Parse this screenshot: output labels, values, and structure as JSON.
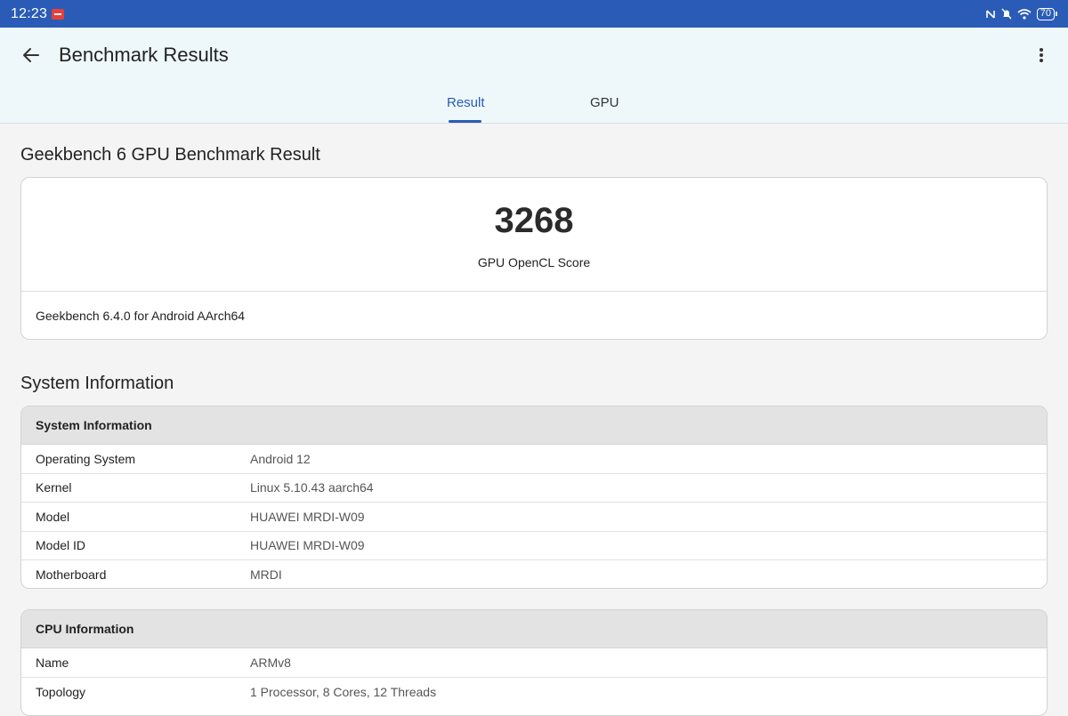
{
  "status_bar": {
    "time": "12:23",
    "battery": "70",
    "icons": [
      "notification-app-icon",
      "nfc-icon",
      "mute-icon",
      "wifi-icon",
      "battery-icon"
    ]
  },
  "header": {
    "title": "Benchmark Results",
    "back_icon": "arrow-left-icon",
    "more_icon": "more-vert-icon"
  },
  "tabs": [
    {
      "label": "Result",
      "selected": true
    },
    {
      "label": "GPU",
      "selected": false
    }
  ],
  "colors": {
    "accent": "#2a5bb7",
    "header_bg": "#eef8fb",
    "page_bg": "#f4f4f4",
    "card_header_bg": "#e3e3e3"
  },
  "benchmark": {
    "section_title": "Geekbench 6 GPU Benchmark Result",
    "score": "3268",
    "score_label": "GPU OpenCL Score",
    "version": "Geekbench 6.4.0 for Android AArch64"
  },
  "system_info": {
    "section_title": "System Information",
    "card_title": "System Information",
    "rows": [
      {
        "key": "Operating System",
        "value": "Android 12"
      },
      {
        "key": "Kernel",
        "value": "Linux 5.10.43 aarch64"
      },
      {
        "key": "Model",
        "value": "HUAWEI MRDI-W09"
      },
      {
        "key": "Model ID",
        "value": "HUAWEI MRDI-W09"
      },
      {
        "key": "Motherboard",
        "value": "MRDI"
      }
    ]
  },
  "cpu_info": {
    "card_title": "CPU Information",
    "rows": [
      {
        "key": "Name",
        "value": "ARMv8"
      },
      {
        "key": "Topology",
        "value": "1 Processor, 8 Cores, 12 Threads"
      }
    ]
  }
}
